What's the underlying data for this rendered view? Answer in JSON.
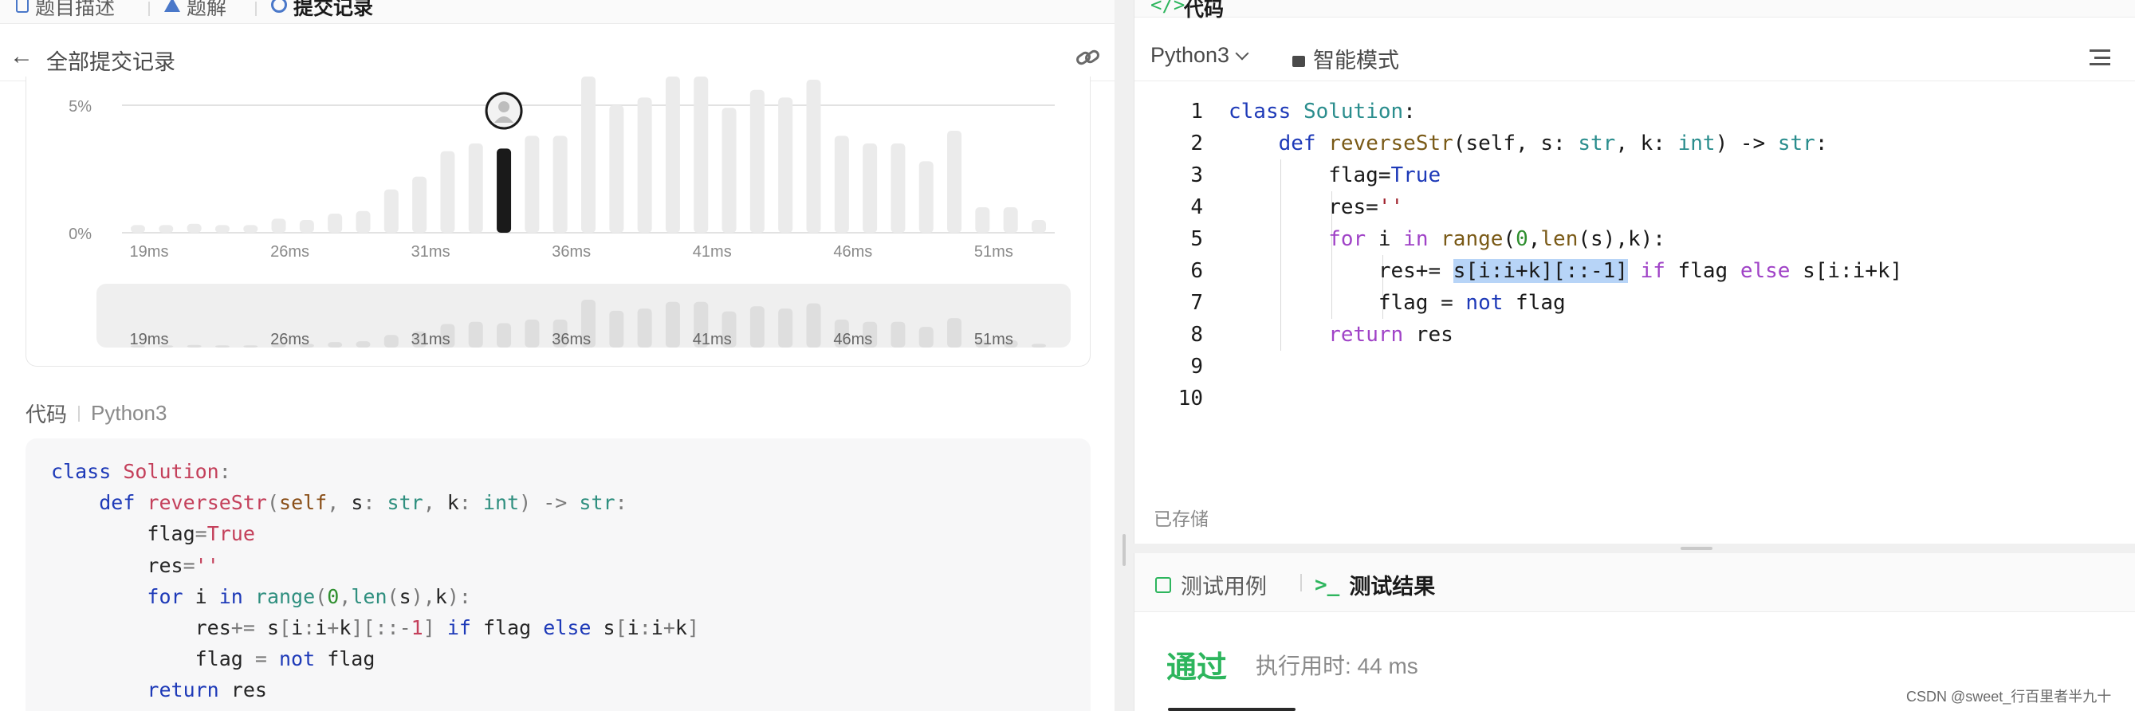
{
  "left_panel": {
    "tabs": [
      {
        "label": "题目描述",
        "active": false,
        "icon": "document-icon"
      },
      {
        "label": "题解",
        "active": false,
        "icon": "flask-icon"
      },
      {
        "label": "提交记录",
        "active": true,
        "icon": "history-icon"
      }
    ],
    "back_label": "全部提交记录",
    "chart_section": {
      "code_label": "代码",
      "language": "Python3"
    },
    "code": [
      "class Solution:",
      "    def reverseStr(self, s: str, k: int) -> str:",
      "        flag=True",
      "        res=''",
      "        for i in range(0,len(s),k):",
      "            res+= s[i:i+k][::-1] if flag else s[i:i+k]",
      "            flag = not flag",
      "        return res"
    ]
  },
  "chart_data": {
    "type": "bar",
    "title": "",
    "ylabel_ticks": [
      "5%",
      "0%"
    ],
    "xtick_labels": [
      "19ms",
      "26ms",
      "31ms",
      "36ms",
      "41ms",
      "46ms",
      "51ms"
    ],
    "ylim": [
      0,
      5
    ],
    "highlighted_bar_index": 13,
    "values": [
      0.3,
      0.3,
      0.35,
      0.3,
      0.3,
      0.55,
      0.5,
      0.75,
      0.85,
      1.7,
      2.2,
      3.2,
      3.5,
      3.3,
      3.8,
      3.8,
      6.5,
      5.0,
      5.3,
      6.2,
      6.2,
      4.9,
      5.6,
      5.3,
      6.0,
      3.8,
      3.5,
      3.5,
      2.8,
      4.0,
      1.0,
      1.0,
      0.5
    ],
    "brush_xtick_labels": [
      "19ms",
      "26ms",
      "31ms",
      "36ms",
      "41ms",
      "46ms",
      "51ms"
    ]
  },
  "editor": {
    "section_label": "代码",
    "language": "Python3",
    "mode": "智能模式",
    "line_numbers": [
      "1",
      "2",
      "3",
      "4",
      "5",
      "6",
      "7",
      "8",
      "9",
      "10"
    ],
    "saved_status": "已存储"
  },
  "result_panel": {
    "tabs": [
      {
        "label": "测试用例",
        "active": false,
        "icon": "checkbox-icon"
      },
      {
        "label": "测试结果",
        "active": true,
        "icon": "terminal-icon"
      }
    ],
    "status": "通过",
    "runtime": "执行用时: 44 ms"
  },
  "watermark": "CSDN @sweet_行百里者半九十",
  "colors": {
    "pass_green": "#2db55d",
    "bar_gray": "#ebebeb",
    "bar_active": "#1a1a1a",
    "selection": "#b7d4f7"
  }
}
